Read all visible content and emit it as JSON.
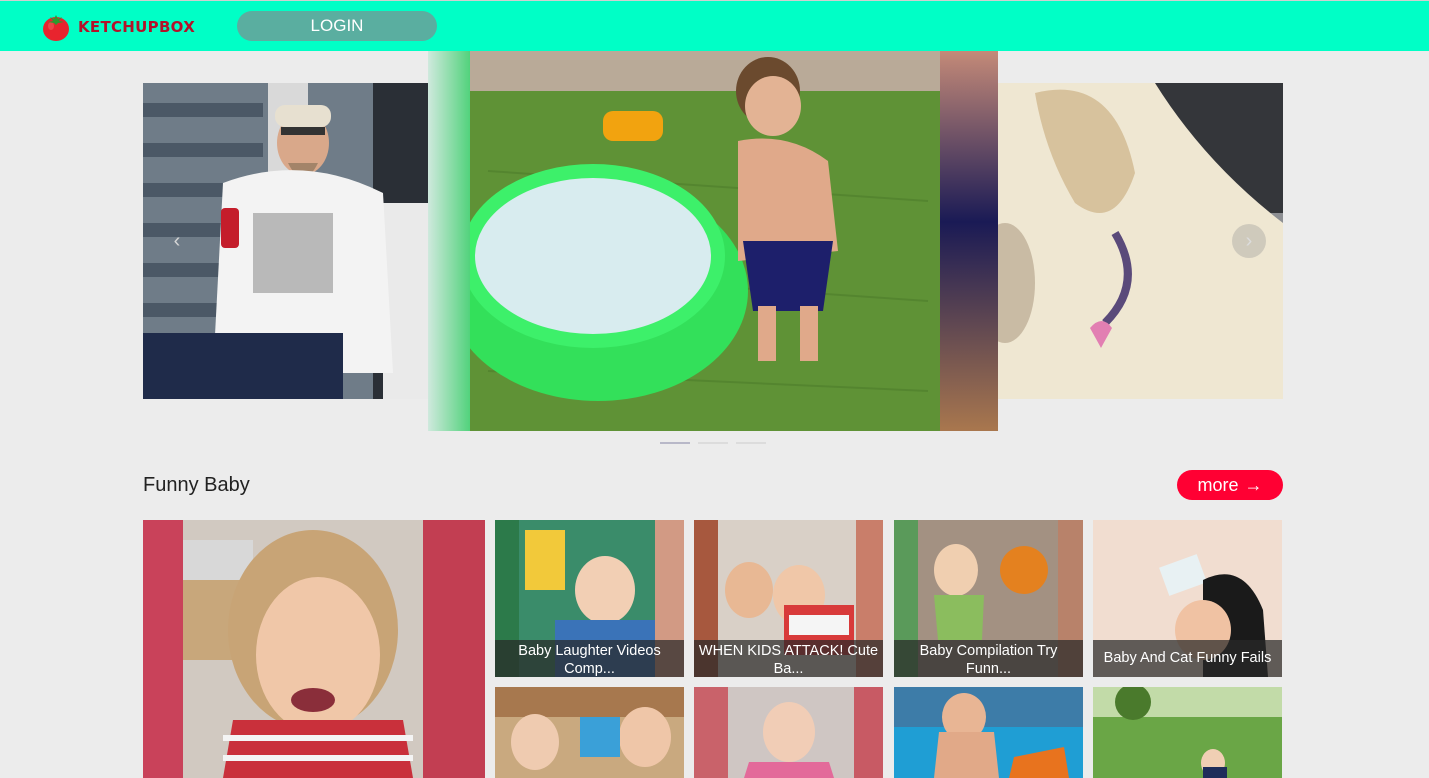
{
  "header": {
    "brand": "KETCHUPBOX",
    "login_label": "LOGIN",
    "accent_color": "#00ffc6",
    "logo_icon": "tomato-icon"
  },
  "carousel": {
    "prev_icon": "chevron-left-icon",
    "next_icon": "chevron-right-icon",
    "prev_glyph": "‹",
    "next_glyph": "›",
    "active_index": 0,
    "slide_count": 3
  },
  "section": {
    "title": "Funny Baby",
    "more_label": "more",
    "more_icon": "arrow-right-icon",
    "more_glyph": "→",
    "more_color": "#ff0033"
  },
  "videos": [
    {
      "title": ""
    },
    {
      "title": "Baby Laughter Videos Comp..."
    },
    {
      "title": "WHEN KIDS ATTACK! Cute Ba..."
    },
    {
      "title": "Baby Compilation Try Funn..."
    },
    {
      "title": "Baby And Cat Funny Fails ..."
    },
    {
      "title": ""
    },
    {
      "title": ""
    },
    {
      "title": ""
    },
    {
      "title": ""
    }
  ]
}
